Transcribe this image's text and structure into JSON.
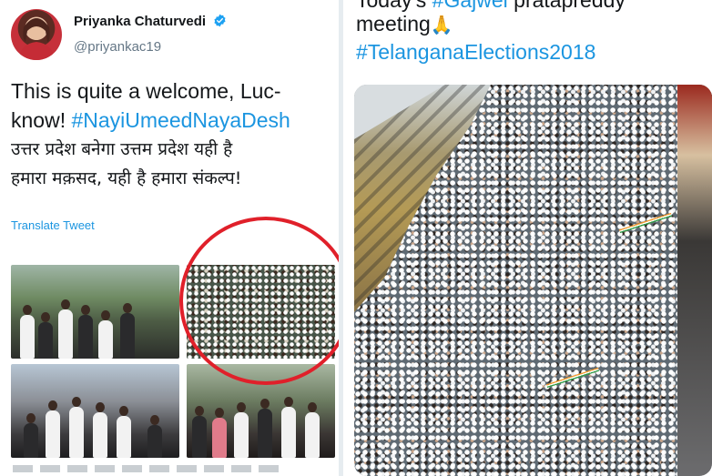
{
  "left_tweet": {
    "display_name": "Priyanka Chaturvedi",
    "handle": "@priyankac19",
    "text_line_1": "This is quite a welcome, Luc-",
    "text_line_2_plain": "know! ",
    "text_line_2_hashtag": "#NayiUmeedNayaDesh",
    "text_line_3": "उत्तर प्रदेश बनेगा उत्तम प्रदेश यही है",
    "text_line_4": "हमारा मक़सद, यही है हमारा संकल्प!",
    "translate_label": "Translate Tweet",
    "icons": [
      "verified-badge-icon"
    ],
    "colors": {
      "link": "#1b95e0",
      "circle": "#e0202a"
    }
  },
  "right_tweet": {
    "line_1_plain": "Today's ",
    "line_1_hashtag": "#Gajwel",
    "line_1_rest": " pratapreddy",
    "line_2": "meeting",
    "line_2_emoji": "🙏",
    "hashtag": "#TelanganaElections2018"
  }
}
